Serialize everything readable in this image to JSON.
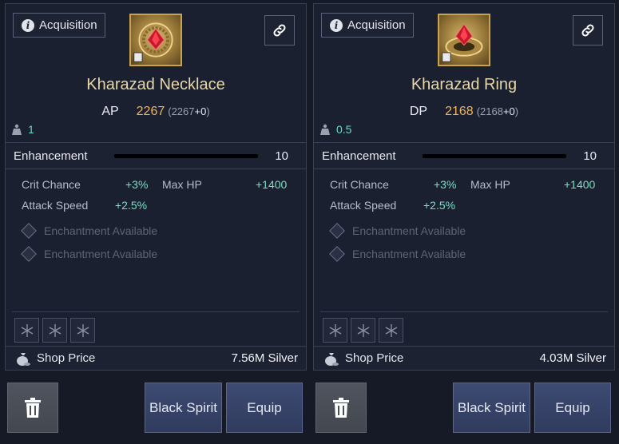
{
  "panels": [
    {
      "acquisition_label": "Acquisition",
      "item_icon": "necklace-icon",
      "item_name": "Kharazad Necklace",
      "stat_label": "AP",
      "stat_value": "2267",
      "stat_base": "(2267",
      "stat_bonus": "+0",
      "stat_close": ")",
      "weight": "1",
      "enhancement_label": "Enhancement",
      "enhancement_value": "10",
      "substats": [
        {
          "label": "Crit Chance",
          "value": "+3%"
        },
        {
          "label": "Max HP",
          "value": "+1400"
        },
        {
          "label": "Attack Speed",
          "value": "+2.5%"
        }
      ],
      "enchantments": [
        "Enchantment Available",
        "Enchantment Available"
      ],
      "price_label": "Shop Price",
      "price_value": "7.56M Silver",
      "black_spirit_label": "Black Spirit",
      "equip_label": "Equip"
    },
    {
      "acquisition_label": "Acquisition",
      "item_icon": "ring-icon",
      "item_name": "Kharazad Ring",
      "stat_label": "DP",
      "stat_value": "2168",
      "stat_base": "(2168",
      "stat_bonus": "+0",
      "stat_close": ")",
      "weight": "0.5",
      "enhancement_label": "Enhancement",
      "enhancement_value": "10",
      "substats": [
        {
          "label": "Crit Chance",
          "value": "+3%"
        },
        {
          "label": "Max HP",
          "value": "+1400"
        },
        {
          "label": "Attack Speed",
          "value": "+2.5%"
        }
      ],
      "enchantments": [
        "Enchantment Available",
        "Enchantment Available"
      ],
      "price_label": "Shop Price",
      "price_value": "4.03M Silver",
      "black_spirit_label": "Black Spirit",
      "equip_label": "Equip"
    }
  ],
  "colors": {
    "item_name": "#e6d7a6",
    "stat_value": "#f0b45a",
    "substat_value": "#76e0c2",
    "weight_value": "#66d8c8"
  }
}
